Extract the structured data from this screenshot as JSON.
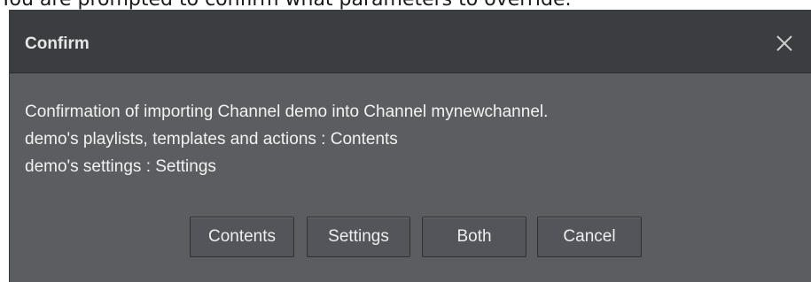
{
  "caption": "You are prompted to confirm what parameters to override.",
  "dialog": {
    "title": "Confirm",
    "close_icon": "close-icon",
    "message_lines": [
      "Confirmation of importing Channel demo into Channel mynewchannel.",
      "demo's playlists, templates and actions : Contents",
      "demo's settings : Settings"
    ],
    "buttons": {
      "contents": "Contents",
      "settings": "Settings",
      "both": "Both",
      "cancel": "Cancel"
    }
  },
  "colors": {
    "titlebar": "#3b3d40",
    "body": "#5b5d60",
    "button": "#53555a",
    "text": "#f2f2f2"
  }
}
